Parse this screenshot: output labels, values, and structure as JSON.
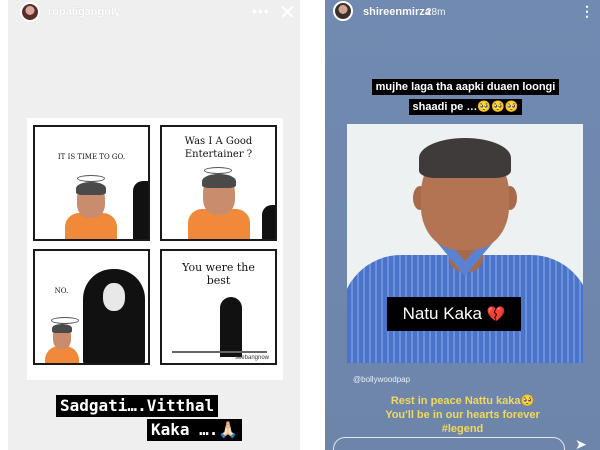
{
  "story_left": {
    "username": "rupaliganguly",
    "time": "2h",
    "menu_icon": "more-horizontal-icon",
    "close_icon": "close-icon",
    "comic": {
      "panel1_text": "IT IS TIME TO GO.",
      "panel2_text": "Was I A Good Entertainer ?",
      "panel3_text": "NO.",
      "panel4_text": "You were the best",
      "signature": "seebangnow"
    },
    "overlay_line1": "Sadgati….Vitthal",
    "overlay_line2": "Kaka ….🙏🏻"
  },
  "story_right": {
    "username": "shireenmirza",
    "time": "28m",
    "menu_icon": "more-vertical-icon",
    "caption": "mujhe laga tha aapki duaen loongi shaadi pe …🥺🥺🥺",
    "photo_label": "Natu Kaka",
    "photo_label_emoji": "💔",
    "credit": "@bollywoodpap",
    "rip_line1": "Rest in peace Nattu kaka🥺",
    "rip_line2": "You'll be in our hearts forever",
    "rip_hashtag": "#legend",
    "send_icon": "send-icon"
  }
}
